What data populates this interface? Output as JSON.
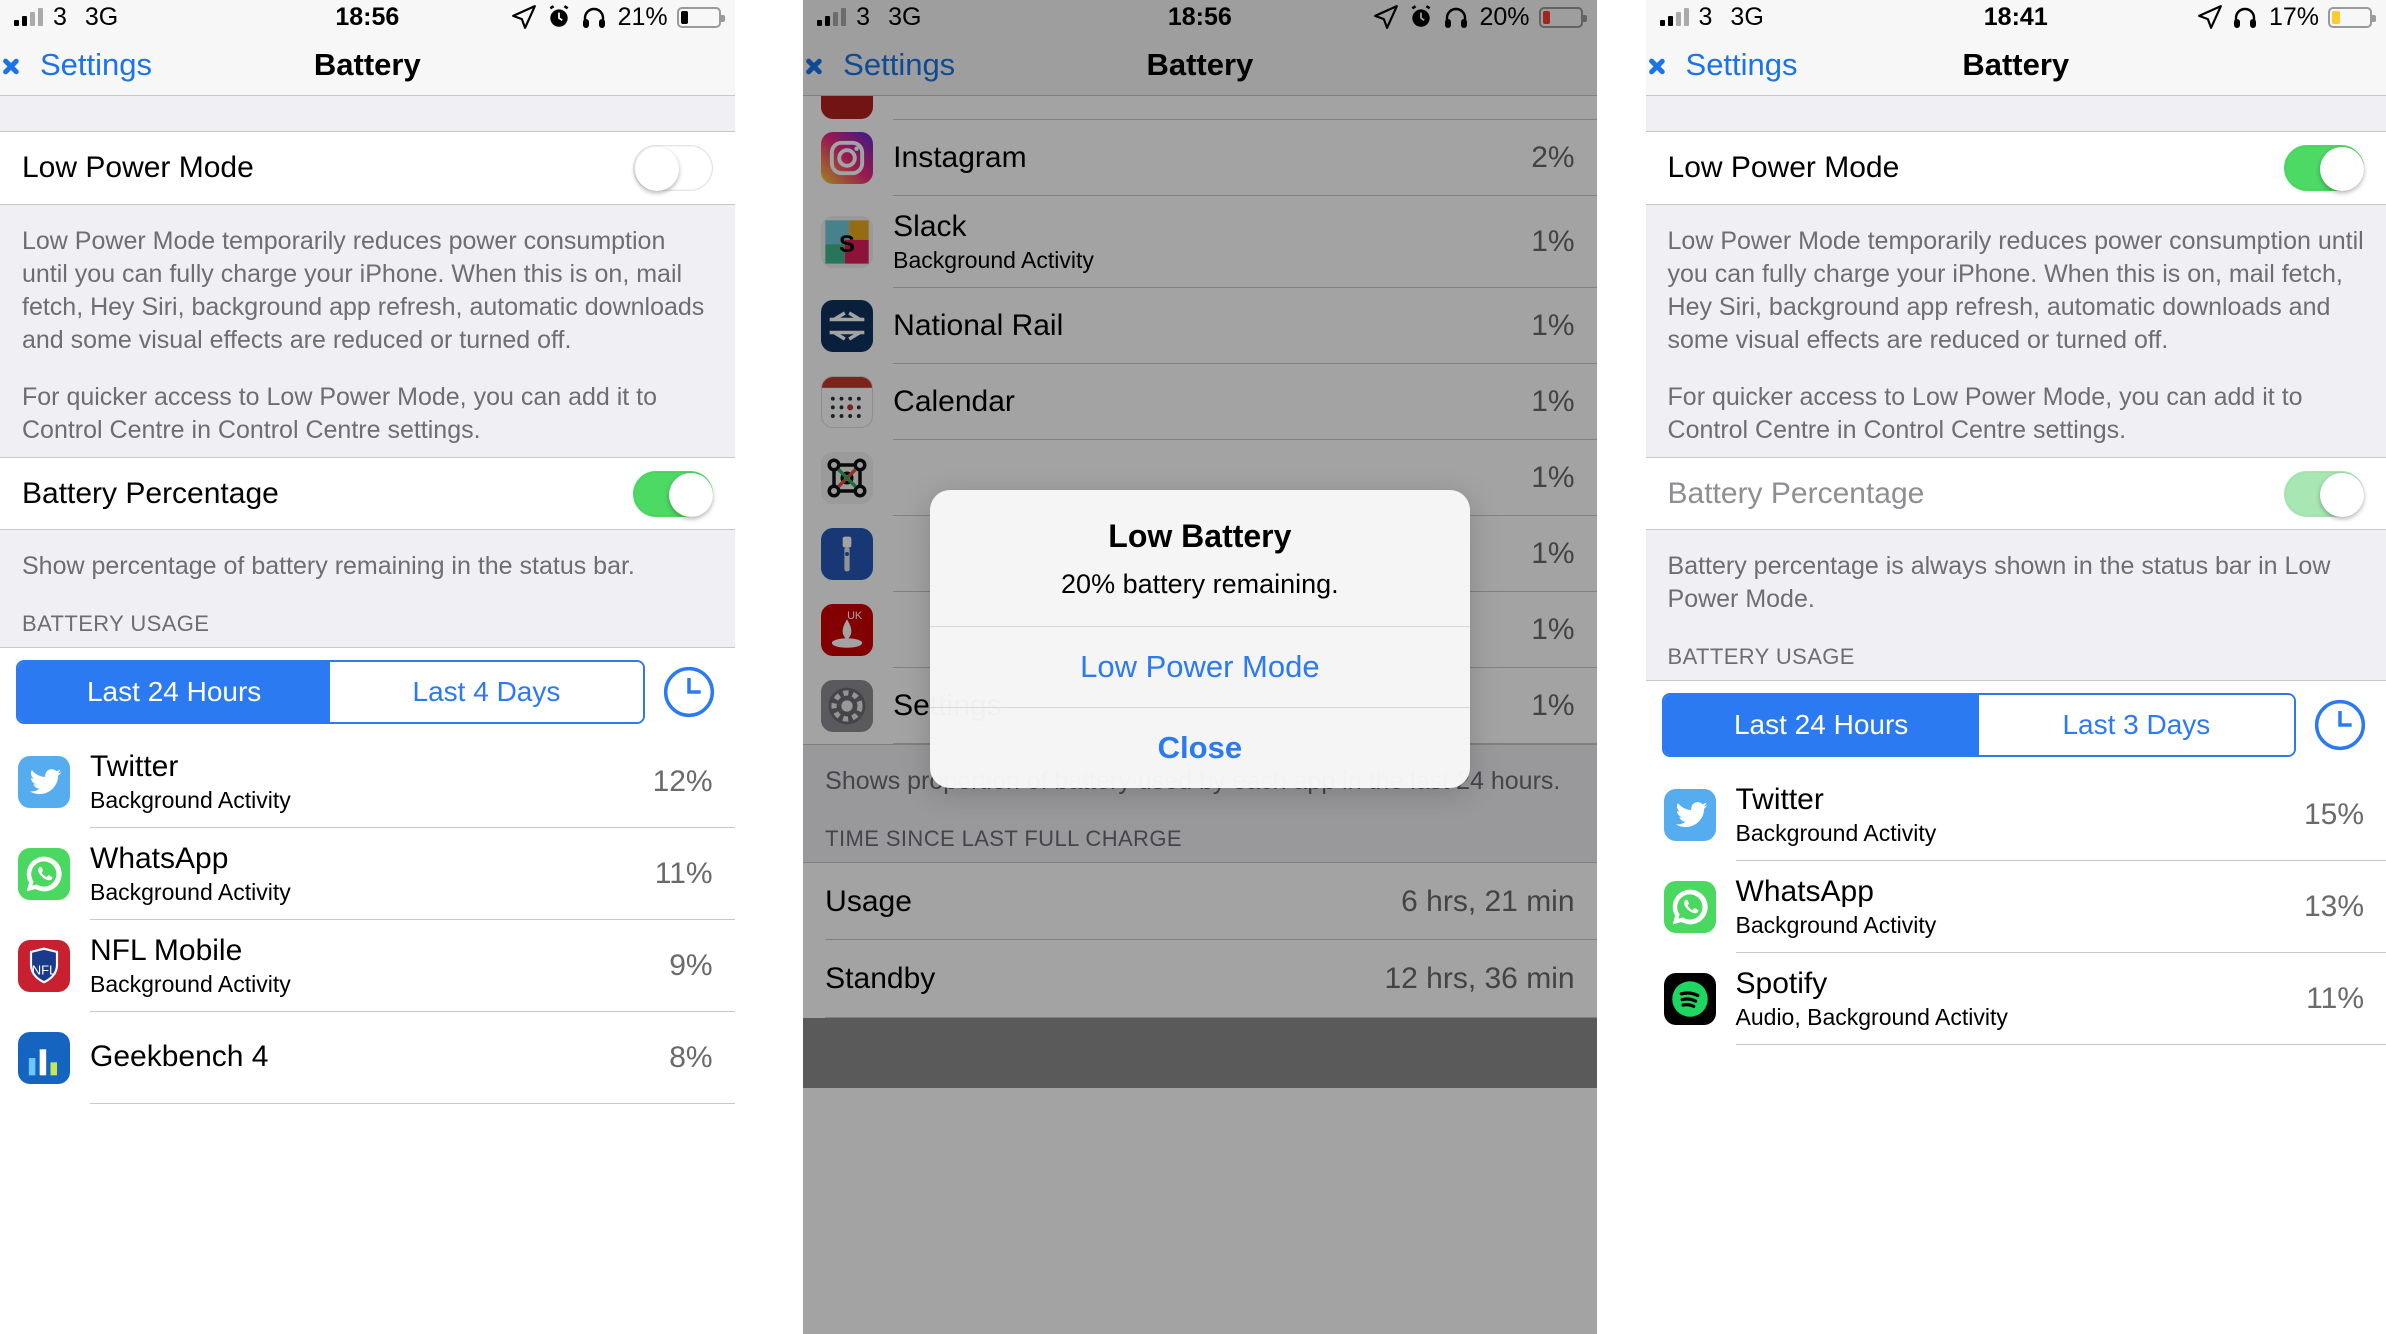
{
  "panels": [
    {
      "id": "panel-low-power-off",
      "status": {
        "carrier": "3",
        "network": "3G",
        "time": "18:56",
        "battery_percent": "21%",
        "battery_level": 21,
        "battery_color": "#000000",
        "icons": [
          "location-arrow-icon",
          "alarm-clock-icon",
          "headphones-icon",
          "battery-icon"
        ]
      },
      "nav": {
        "back_label": "Settings",
        "title": "Battery"
      },
      "low_power_mode": {
        "label": "Low Power Mode",
        "enabled": false
      },
      "low_power_footer_1": "Low Power Mode temporarily reduces power consumption until you can fully charge your iPhone. When this is on, mail fetch, Hey Siri, background app refresh, automatic downloads and some visual effects are reduced or turned off.",
      "low_power_footer_2": "For quicker access to Low Power Mode, you can add it to Control Centre in Control Centre settings.",
      "battery_percentage": {
        "label": "Battery Percentage",
        "enabled": true,
        "disabled_style": false
      },
      "battery_percentage_footer": "Show percentage of battery remaining in the status bar.",
      "usage_header": "BATTERY USAGE",
      "segments": {
        "options": [
          "Last 24 Hours",
          "Last 4 Days"
        ],
        "selected": 0
      },
      "apps": [
        {
          "name": "Twitter",
          "sub": "Background Activity",
          "percent": "12%",
          "icon": "twitter-icon"
        },
        {
          "name": "WhatsApp",
          "sub": "Background Activity",
          "percent": "11%",
          "icon": "whatsapp-icon"
        },
        {
          "name": "NFL Mobile",
          "sub": "Background Activity",
          "percent": "9%",
          "icon": "nfl-icon"
        },
        {
          "name": "Geekbench 4",
          "sub": "",
          "percent": "8%",
          "icon": "geekbench-icon"
        }
      ]
    },
    {
      "id": "panel-low-battery-alert",
      "status": {
        "carrier": "3",
        "network": "3G",
        "time": "18:56",
        "battery_percent": "20%",
        "battery_level": 20,
        "battery_color": "#ff3b30",
        "icons": [
          "location-arrow-icon",
          "alarm-clock-icon",
          "headphones-icon",
          "battery-icon"
        ]
      },
      "nav": {
        "back_label": "Settings",
        "title": "Battery"
      },
      "apps": [
        {
          "name": "Instagram",
          "sub": "",
          "percent": "2%",
          "icon": "instagram-icon"
        },
        {
          "name": "Slack",
          "sub": "Background Activity",
          "percent": "1%",
          "icon": "slack-icon"
        },
        {
          "name": "National Rail",
          "sub": "",
          "percent": "1%",
          "icon": "national-rail-icon"
        },
        {
          "name": "Calendar",
          "sub": "",
          "percent": "1%",
          "icon": "calendar-icon"
        },
        {
          "name": "",
          "sub": "",
          "percent": "1%",
          "icon": "citymapper-icon"
        },
        {
          "name": "",
          "sub": "",
          "percent": "1%",
          "icon": "torch-icon"
        },
        {
          "name": "",
          "sub": "",
          "percent": "1%",
          "icon": "santander-icon"
        },
        {
          "name": "Settings",
          "sub": "",
          "percent": "1%",
          "icon": "settings-gear-icon"
        }
      ],
      "usage_footer": "Shows proportion of battery used by each app in the last 24 hours.",
      "charge_header": "TIME SINCE LAST FULL CHARGE",
      "charge_rows": [
        {
          "key": "Usage",
          "value": "6 hrs, 21 min"
        },
        {
          "key": "Standby",
          "value": "12 hrs, 36 min"
        }
      ],
      "alert": {
        "title": "Low Battery",
        "message": "20% battery remaining.",
        "primary_button": "Low Power Mode",
        "secondary_button": "Close"
      }
    },
    {
      "id": "panel-low-power-on",
      "status": {
        "carrier": "3",
        "network": "3G",
        "time": "18:41",
        "battery_percent": "17%",
        "battery_level": 17,
        "battery_color": "#fdcb2e",
        "icons": [
          "location-arrow-icon",
          "headphones-icon",
          "battery-icon"
        ]
      },
      "nav": {
        "back_label": "Settings",
        "title": "Battery"
      },
      "low_power_mode": {
        "label": "Low Power Mode",
        "enabled": true
      },
      "low_power_footer_1": "Low Power Mode temporarily reduces power consumption until you can fully charge your iPhone. When this is on, mail fetch, Hey Siri, background app refresh, automatic downloads and some visual effects are reduced or turned off.",
      "low_power_footer_2": "For quicker access to Low Power Mode, you can add it to Control Centre in Control Centre settings.",
      "battery_percentage": {
        "label": "Battery Percentage",
        "enabled": true,
        "disabled_style": true
      },
      "battery_percentage_footer": "Battery percentage is always shown in the status bar in Low Power Mode.",
      "usage_header": "BATTERY USAGE",
      "segments": {
        "options": [
          "Last 24 Hours",
          "Last 3 Days"
        ],
        "selected": 0
      },
      "apps": [
        {
          "name": "Twitter",
          "sub": "Background Activity",
          "percent": "15%",
          "icon": "twitter-icon"
        },
        {
          "name": "WhatsApp",
          "sub": "Background Activity",
          "percent": "13%",
          "icon": "whatsapp-icon"
        },
        {
          "name": "Spotify",
          "sub": "Audio, Background Activity",
          "percent": "11%",
          "icon": "spotify-icon"
        }
      ]
    }
  ],
  "colors": {
    "tint": "#007aff",
    "segment_blue": "#2b7af2",
    "switch_on": "#4cd964",
    "switch_on_faded": "#a8e6b4",
    "group_bg": "#efeff4",
    "separator": "#c8c7cc",
    "secondary_text": "#6d6d72",
    "battery_low_yellow": "#fdcb2e",
    "battery_low_red": "#ff3b30"
  }
}
